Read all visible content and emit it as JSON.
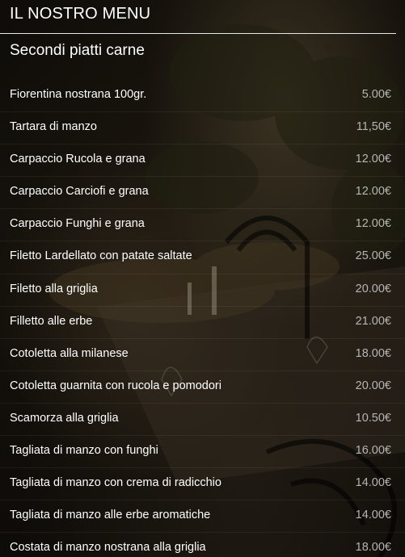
{
  "header": {
    "title": "IL NOSTRO MENU"
  },
  "section": {
    "title": "Secondi piatti carne"
  },
  "menu": {
    "items": [
      {
        "name": "Fiorentina nostrana 100gr.",
        "price": "5.00€"
      },
      {
        "name": "Tartara di manzo",
        "price": "11,50€"
      },
      {
        "name": "Carpaccio Rucola e grana",
        "price": "12.00€"
      },
      {
        "name": "Carpaccio Carciofi e grana",
        "price": "12.00€"
      },
      {
        "name": "Carpaccio Funghi e grana",
        "price": "12.00€"
      },
      {
        "name": "Filetto Lardellato con patate saltate",
        "price": "25.00€"
      },
      {
        "name": "Filetto alla griglia",
        "price": "20.00€"
      },
      {
        "name": "Filletto alle erbe",
        "price": "21.00€"
      },
      {
        "name": "Cotoletta alla milanese",
        "price": "18.00€"
      },
      {
        "name": "Cotoletta guarnita con rucola e pomodori",
        "price": "20.00€"
      },
      {
        "name": "Scamorza alla griglia",
        "price": "10.50€"
      },
      {
        "name": "Tagliata di manzo con funghi",
        "price": "16.00€"
      },
      {
        "name": "Tagliata di manzo con crema di radicchio",
        "price": "14.00€"
      },
      {
        "name": "Tagliata di manzo alle erbe aromatiche",
        "price": "14.00€"
      },
      {
        "name": "Costata di manzo nostrana alla griglia",
        "price": "18.00€"
      }
    ]
  },
  "colors": {
    "text": "#ffffff",
    "price": "#b5b5b5",
    "background": "#14110c"
  }
}
